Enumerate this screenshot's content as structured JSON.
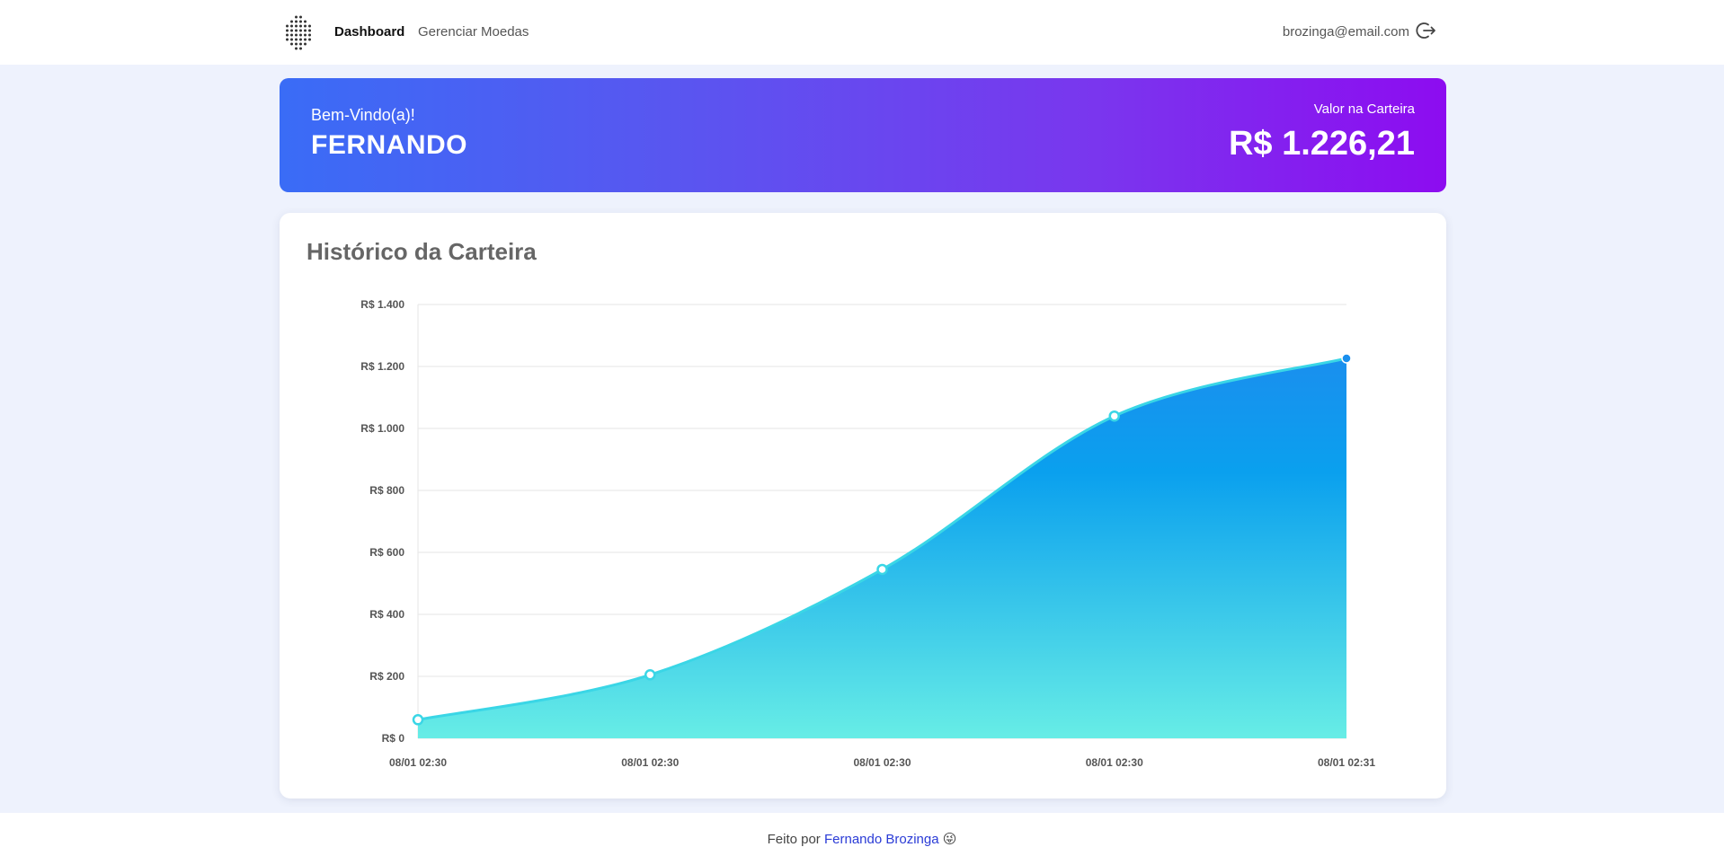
{
  "nav": {
    "logo_icon": "dotted-sphere-icon",
    "dashboard_label": "Dashboard",
    "manage_label": "Gerenciar Moedas",
    "user_email": "brozinga@email.com",
    "logout_icon": "logout-icon"
  },
  "banner": {
    "welcome": "Bem-Vindo(a)!",
    "username": "FERNANDO",
    "wallet_label": "Valor na Carteira",
    "wallet_value": "R$ 1.226,21"
  },
  "card": {
    "title": "Histórico da Carteira"
  },
  "chart_data": {
    "type": "area",
    "title": "Histórico da Carteira",
    "x": [
      "08/01 02:30",
      "08/01 02:30",
      "08/01 02:30",
      "08/01 02:30",
      "08/01 02:31"
    ],
    "series": [
      {
        "values": [
          60,
          205,
          545,
          1040,
          1226.21
        ]
      }
    ],
    "y_tick_labels": [
      "R$ 0",
      "R$ 200",
      "R$ 400",
      "R$ 600",
      "R$ 800",
      "R$ 1.000",
      "R$ 1.200",
      "R$ 1.400"
    ],
    "ylim": [
      0,
      1400
    ],
    "grid": true,
    "colors": {
      "top": "#1a8fee",
      "bottom": "#67ede6",
      "line": "#3ad6e6"
    }
  },
  "footer": {
    "prefix": "Feito por ",
    "author": "Fernando Brozinga",
    "emoji": "😜"
  }
}
